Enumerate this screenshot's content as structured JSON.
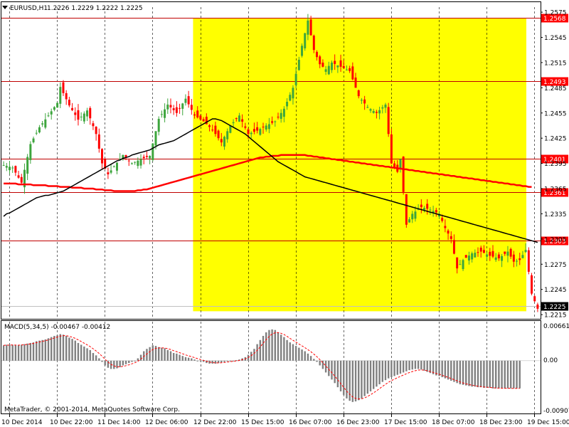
{
  "header": {
    "symbol_tf": "EURUSD,H1",
    "ohlc": "1.2226 1.2229 1.2222 1.2225"
  },
  "macd": {
    "label": "MACD(5,34,5) -0.00467 -0.00412",
    "ticks": [
      "0.00661",
      "0.00",
      "-0.00907"
    ]
  },
  "copyright": "MetaTrader, © 2001-2014, MetaQuotes Software Corp.",
  "colors": {
    "up_candle": "#3da53d",
    "down_candle": "#ff0000",
    "ma_fast": "#000000",
    "ma_slow": "#ff0000",
    "zone": "#ffff00",
    "level": "#c00000",
    "macd_hist": "#808080",
    "macd_signal": "#ff0000"
  },
  "chart_data": {
    "type": "candlestick",
    "symbol": "EURUSD",
    "timeframe": "H1",
    "price_ticks": [
      "1.2575",
      "1.2545",
      "1.2515",
      "1.2485",
      "1.2455",
      "1.2425",
      "1.2395",
      "1.2365",
      "1.2335",
      "1.2305",
      "1.2275",
      "1.2245",
      "1.2215"
    ],
    "ylim": [
      1.221,
      1.2581
    ],
    "time_labels": [
      "10 Dec 2014",
      "10 Dec 22:00",
      "11 Dec 14:00",
      "12 Dec 06:00",
      "12 Dec 22:00",
      "15 Dec 15:00",
      "16 Dec 07:00",
      "16 Dec 23:00",
      "17 Dec 15:00",
      "18 Dec 07:00",
      "18 Dec 23:00",
      "19 Dec 15:00"
    ],
    "levels": [
      "1.2568",
      "1.2493",
      "1.2401",
      "1.2361",
      "1.2303"
    ],
    "current_price": "1.2225",
    "highlight_zone": {
      "from_bar": 64,
      "price_from": 1.2219,
      "price_to": 1.2568
    },
    "ma_fast": [
      1.2332,
      1.2335,
      1.2336,
      1.2338,
      1.234,
      1.2342,
      1.2344,
      1.2346,
      1.2348,
      1.235,
      1.2352,
      1.2354,
      1.2355,
      1.2356,
      1.2357,
      1.2357,
      1.2358,
      1.2359,
      1.236,
      1.2361,
      1.2362,
      1.2364,
      1.2366,
      1.2368,
      1.237,
      1.2372,
      1.2374,
      1.2376,
      1.2378,
      1.238,
      1.2382,
      1.2384,
      1.2386,
      1.2388,
      1.239,
      1.2392,
      1.2394,
      1.2396,
      1.2398,
      1.2399,
      1.2401,
      1.2402,
      1.2403,
      1.2405,
      1.2406,
      1.2407,
      1.2408,
      1.2409,
      1.241,
      1.2411,
      1.2413,
      1.2415,
      1.2417,
      1.2418,
      1.2419,
      1.242,
      1.2421,
      1.2422,
      1.2424,
      1.2426,
      1.2428,
      1.243,
      1.2432,
      1.2434,
      1.2436,
      1.2438,
      1.244,
      1.2442,
      1.2444,
      1.2446,
      1.2448,
      1.2448,
      1.2447,
      1.2446,
      1.2444,
      1.2442,
      1.244,
      1.2438,
      1.2436,
      1.2434,
      1.2432,
      1.243,
      1.2427,
      1.2424,
      1.2421,
      1.2418,
      1.2415,
      1.2412,
      1.2409,
      1.2406,
      1.2403,
      1.24,
      1.2397,
      1.2395,
      1.2393,
      1.2391,
      1.2389,
      1.2387,
      1.2385,
      1.2383,
      1.2381,
      1.2379,
      1.2378,
      1.2377,
      1.2376,
      1.2375,
      1.2374,
      1.2373,
      1.2372,
      1.2371,
      1.237,
      1.2369,
      1.2368,
      1.2367,
      1.2366,
      1.2365,
      1.2364,
      1.2363,
      1.2362,
      1.2361,
      1.236,
      1.2359,
      1.2358,
      1.2357,
      1.2356,
      1.2355,
      1.2354,
      1.2353,
      1.2352,
      1.2351,
      1.235,
      1.2349,
      1.2348,
      1.2347,
      1.2346,
      1.2345,
      1.2344,
      1.2343,
      1.2342,
      1.2341,
      1.234,
      1.2339,
      1.2338,
      1.2337,
      1.2336,
      1.2335,
      1.2334,
      1.2333,
      1.2332,
      1.2331,
      1.233,
      1.2329,
      1.2328,
      1.2327,
      1.2326,
      1.2325,
      1.2324,
      1.2323,
      1.2322,
      1.2321,
      1.232,
      1.2319,
      1.2318,
      1.2317,
      1.2316,
      1.2315,
      1.2314,
      1.2313,
      1.2312,
      1.2311,
      1.231,
      1.2309,
      1.2308,
      1.2307,
      1.2306,
      1.2305,
      1.2304,
      1.2303,
      1.2302,
      1.2301
    ],
    "ma_slow": [
      1.2371,
      1.2371,
      1.2371,
      1.2371,
      1.2371,
      1.237,
      1.237,
      1.237,
      1.237,
      1.237,
      1.2369,
      1.2369,
      1.2369,
      1.2369,
      1.2369,
      1.2368,
      1.2368,
      1.2368,
      1.2368,
      1.2367,
      1.2367,
      1.2367,
      1.2367,
      1.2366,
      1.2366,
      1.2366,
      1.2366,
      1.2365,
      1.2365,
      1.2365,
      1.2365,
      1.2364,
      1.2364,
      1.2364,
      1.2363,
      1.2363,
      1.2363,
      1.2362,
      1.2362,
      1.2362,
      1.2362,
      1.2362,
      1.2362,
      1.2362,
      1.2362,
      1.2363,
      1.2363,
      1.2364,
      1.2364,
      1.2365,
      1.2366,
      1.2367,
      1.2368,
      1.2369,
      1.237,
      1.2371,
      1.2372,
      1.2373,
      1.2374,
      1.2375,
      1.2376,
      1.2377,
      1.2378,
      1.2379,
      1.238,
      1.2381,
      1.2382,
      1.2383,
      1.2384,
      1.2385,
      1.2386,
      1.2387,
      1.2388,
      1.2389,
      1.239,
      1.2391,
      1.2392,
      1.2393,
      1.2394,
      1.2395,
      1.2396,
      1.2397,
      1.2398,
      1.2399,
      1.24,
      1.2401,
      1.2402,
      1.2402,
      1.2403,
      1.2403,
      1.2404,
      1.2404,
      1.2404,
      1.2405,
      1.2405,
      1.2405,
      1.2405,
      1.2405,
      1.2405,
      1.2405,
      1.2405,
      1.2405,
      1.2404,
      1.2404,
      1.2403,
      1.2403,
      1.2402,
      1.2402,
      1.2401,
      1.2401,
      1.24,
      1.24,
      1.2399,
      1.2399,
      1.2398,
      1.2398,
      1.2397,
      1.2397,
      1.2396,
      1.2396,
      1.2395,
      1.2395,
      1.2394,
      1.2394,
      1.2393,
      1.2393,
      1.2392,
      1.2392,
      1.2391,
      1.2391,
      1.239,
      1.239,
      1.2389,
      1.2389,
      1.2388,
      1.2388,
      1.2387,
      1.2387,
      1.2386,
      1.2386,
      1.2385,
      1.2385,
      1.2384,
      1.2384,
      1.2383,
      1.2383,
      1.2382,
      1.2382,
      1.2381,
      1.2381,
      1.238,
      1.238,
      1.2379,
      1.2379,
      1.2378,
      1.2378,
      1.2377,
      1.2377,
      1.2376,
      1.2376,
      1.2375,
      1.2375,
      1.2374,
      1.2374,
      1.2373,
      1.2373,
      1.2372,
      1.2372,
      1.2371,
      1.2371,
      1.237,
      1.237,
      1.2369,
      1.2369,
      1.2368,
      1.2368,
      1.2367,
      1.2367
    ],
    "close_path": [
      [
        0,
        1.2393
      ],
      [
        3,
        1.239
      ],
      [
        6,
        1.2372
      ],
      [
        9,
        1.2418
      ],
      [
        12,
        1.2438
      ],
      [
        15,
        1.2452
      ],
      [
        18,
        1.2467
      ],
      [
        19,
        1.2486
      ],
      [
        22,
        1.2464
      ],
      [
        25,
        1.2447
      ],
      [
        28,
        1.2458
      ],
      [
        31,
        1.243
      ],
      [
        33,
        1.2395
      ],
      [
        35,
        1.2382
      ],
      [
        38,
        1.2396
      ],
      [
        40,
        1.2405
      ],
      [
        43,
        1.2395
      ],
      [
        46,
        1.24
      ],
      [
        49,
        1.2404
      ],
      [
        52,
        1.2448
      ],
      [
        55,
        1.2465
      ],
      [
        58,
        1.2455
      ],
      [
        61,
        1.2472
      ],
      [
        64,
        1.2452
      ],
      [
        67,
        1.2445
      ],
      [
        70,
        1.2435
      ],
      [
        73,
        1.242
      ],
      [
        76,
        1.244
      ],
      [
        79,
        1.2452
      ],
      [
        82,
        1.243
      ],
      [
        85,
        1.2434
      ],
      [
        88,
        1.244
      ],
      [
        91,
        1.2445
      ],
      [
        94,
        1.246
      ],
      [
        97,
        1.2485
      ],
      [
        100,
        1.2535
      ],
      [
        102,
        1.2565
      ],
      [
        104,
        1.253
      ],
      [
        106,
        1.2513
      ],
      [
        108,
        1.2507
      ],
      [
        110,
        1.2515
      ],
      [
        113,
        1.251
      ],
      [
        116,
        1.2505
      ],
      [
        119,
        1.2475
      ],
      [
        122,
        1.2462
      ],
      [
        125,
        1.2455
      ],
      [
        128,
        1.2465
      ],
      [
        130,
        1.2395
      ],
      [
        132,
        1.2385
      ],
      [
        133,
        1.24
      ],
      [
        135,
        1.2322
      ],
      [
        137,
        1.2335
      ],
      [
        140,
        1.2343
      ],
      [
        143,
        1.234
      ],
      [
        146,
        1.2335
      ],
      [
        148,
        1.2318
      ],
      [
        150,
        1.2305
      ],
      [
        152,
        1.227
      ],
      [
        154,
        1.228
      ],
      [
        157,
        1.2288
      ],
      [
        160,
        1.229
      ],
      [
        163,
        1.2285
      ],
      [
        166,
        1.2282
      ],
      [
        169,
        1.229
      ],
      [
        171,
        1.2278
      ],
      [
        173,
        1.228
      ],
      [
        175,
        1.2292
      ],
      [
        177,
        1.224
      ],
      [
        179,
        1.2222
      ],
      [
        181,
        1.2225
      ]
    ],
    "macd_bars": [
      0.0026,
      0.0027,
      0.0027,
      0.0027,
      0.0026,
      0.0026,
      0.0027,
      0.0028,
      0.0029,
      0.003,
      0.0031,
      0.0033,
      0.0034,
      0.0035,
      0.0036,
      0.0038,
      0.004,
      0.0042,
      0.0043,
      0.0045,
      0.0044,
      0.0042,
      0.0039,
      0.0037,
      0.0034,
      0.003,
      0.0027,
      0.0024,
      0.0021,
      0.0018,
      0.0013,
      0.0009,
      0.0004,
      -0.0002,
      -0.0008,
      -0.0012,
      -0.0014,
      -0.0014,
      -0.0013,
      -0.0011,
      -0.0008,
      -0.0006,
      -0.0004,
      -0.0002,
      0.0,
      0.0004,
      0.001,
      0.0016,
      0.002,
      0.0023,
      0.0026,
      0.0025,
      0.0023,
      0.0022,
      0.0021,
      0.0018,
      0.0016,
      0.0013,
      0.0012,
      0.001,
      0.0008,
      0.0006,
      0.0005,
      0.0004,
      0.0002,
      0.0,
      -0.0001,
      -0.0002,
      -0.0004,
      -0.0005,
      -0.0005,
      -0.0005,
      -0.0004,
      -0.0003,
      -0.0002,
      -0.0001,
      0.0,
      0.0,
      0.0001,
      0.0002,
      0.0004,
      0.0006,
      0.001,
      0.0015,
      0.002,
      0.0028,
      0.0035,
      0.0042,
      0.0048,
      0.0052,
      0.0053,
      0.0052,
      0.0048,
      0.0044,
      0.004,
      0.0035,
      0.0031,
      0.0028,
      0.0025,
      0.0022,
      0.0019,
      0.0016,
      0.0012,
      0.0008,
      0.0003,
      -0.0002,
      -0.0008,
      -0.0014,
      -0.002,
      -0.0026,
      -0.0032,
      -0.0038,
      -0.0045,
      -0.0052,
      -0.0058,
      -0.0064,
      -0.0068,
      -0.007,
      -0.0069,
      -0.0067,
      -0.0064,
      -0.006,
      -0.0056,
      -0.0052,
      -0.0048,
      -0.0044,
      -0.004,
      -0.0036,
      -0.0033,
      -0.003,
      -0.0028,
      -0.0026,
      -0.0024,
      -0.0022,
      -0.002,
      -0.0018,
      -0.0016,
      -0.0015,
      -0.0014,
      -0.0014,
      -0.0015,
      -0.0017,
      -0.0019,
      -0.0021,
      -0.0023,
      -0.0025,
      -0.0026,
      -0.0028,
      -0.003,
      -0.0032,
      -0.0034,
      -0.0036,
      -0.0038,
      -0.004,
      -0.0041,
      -0.0042,
      -0.0043,
      -0.0044,
      -0.0044,
      -0.0045,
      -0.0045,
      -0.0046,
      -0.0046,
      -0.0046,
      -0.0047,
      -0.0047,
      -0.0047,
      -0.0047,
      -0.0047,
      -0.0047,
      -0.0047,
      -0.0047,
      -0.0047,
      -0.0047
    ],
    "macd_ylim": [
      -0.00907,
      0.00661
    ]
  }
}
